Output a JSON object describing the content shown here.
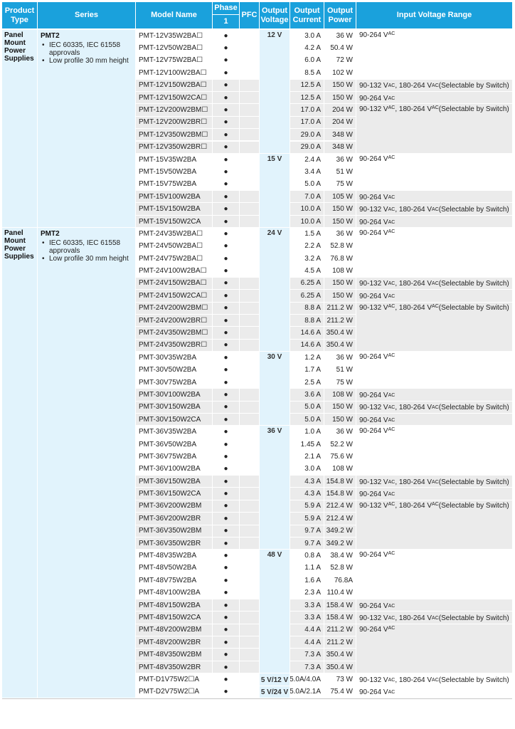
{
  "header": {
    "product_type": "Product Type",
    "series": "Series",
    "model_name": "Model Name",
    "phase": "Phase",
    "phase_sub": "1",
    "pfc": "PFC",
    "output_voltage": "Output Voltage",
    "output_current": "Output Current",
    "output_power": "Output Power",
    "input_voltage_range": "Input Voltage Range"
  },
  "sections": [
    {
      "product_type": "Panel Mount Power Supplies",
      "series_name": "PMT2",
      "series_bullets": [
        "IEC 60335, IEC 61558 approvals",
        "Low profile 30 mm height"
      ]
    },
    {
      "product_type": "Panel Mount Power Supplies",
      "series_name": "PMT2",
      "series_bullets": [
        "IEC 60335, IEC 61558 approvals",
        "Low profile 30 mm height"
      ]
    }
  ],
  "phase_mark": "●",
  "voltage_groups": [
    "12 V",
    "15 V",
    "24 V",
    "30 V",
    "36 V",
    "48 V",
    "5 V/12 V",
    "5 V/24 V"
  ],
  "input_ranges": [
    "90-264 VAC",
    "90-132 VAC, 180-264 VAC (Selectable by Switch)",
    "90-264 VAC",
    "90-132 VAC, 180-264 VAC (Selectable by Switch)",
    "90-264 VAC",
    "90-264 VAC",
    "90-132 VAC, 180-264 VAC (Selectable by Switch)",
    "90-264 VAC",
    "90-264 VAC",
    "90-132 VAC, 180-264 VAC (Selectable by Switch)",
    "90-264 VAC",
    "90-132 VAC, 180-264 VAC (Selectable by Switch)",
    "90-264 VAC",
    "90-264 VAC",
    "90-132 VAC, 180-264 VAC (Selectable by Switch)",
    "90-264 VAC",
    "90-264 VAC",
    "90-132 VAC, 180-264 VAC (Selectable by Switch)",
    "90-264 VAC",
    "90-132 VAC, 180-264 VAC (Selectable by Switch)",
    "90-264 VAC",
    "90-264 VAC",
    "90-132 VAC, 180-264 VAC (Selectable by Switch)",
    "90-264 VAC",
    "90-132 VAC, 180-264 VAC (Selectable by Switch)",
    "90-264 VAC"
  ],
  "rows": [
    {
      "model": "PMT-12V35W2BA☐",
      "current": "3.0 A",
      "power": "36 W"
    },
    {
      "model": "PMT-12V50W2BA☐",
      "current": "4.2 A",
      "power": "50.4 W"
    },
    {
      "model": "PMT-12V75W2BA☐",
      "current": "6.0 A",
      "power": "72 W"
    },
    {
      "model": "PMT-12V100W2BA☐",
      "current": "8.5 A",
      "power": "102 W"
    },
    {
      "model": "PMT-12V150W2BA☐",
      "current": "12.5 A",
      "power": "150 W"
    },
    {
      "model": "PMT-12V150W2CA☐",
      "current": "12.5 A",
      "power": "150 W"
    },
    {
      "model": "PMT-12V200W2BM☐",
      "current": "17.0 A",
      "power": "204 W"
    },
    {
      "model": "PMT-12V200W2BR☐",
      "current": "17.0 A",
      "power": "204 W"
    },
    {
      "model": "PMT-12V350W2BM☐",
      "current": "29.0 A",
      "power": "348 W"
    },
    {
      "model": "PMT-12V350W2BR☐",
      "current": "29.0 A",
      "power": "348 W"
    },
    {
      "model": "PMT-15V35W2BA",
      "current": "2.4 A",
      "power": "36 W"
    },
    {
      "model": "PMT-15V50W2BA",
      "current": "3.4 A",
      "power": "51 W"
    },
    {
      "model": "PMT-15V75W2BA",
      "current": "5.0 A",
      "power": "75 W"
    },
    {
      "model": "PMT-15V100W2BA",
      "current": "7.0 A",
      "power": "105 W"
    },
    {
      "model": "PMT-15V150W2BA",
      "current": "10.0 A",
      "power": "150 W"
    },
    {
      "model": "PMT-15V150W2CA",
      "current": "10.0 A",
      "power": "150 W"
    },
    {
      "model": "PMT-24V35W2BA☐",
      "current": "1.5 A",
      "power": "36 W"
    },
    {
      "model": "PMT-24V50W2BA☐",
      "current": "2.2 A",
      "power": "52.8 W"
    },
    {
      "model": "PMT-24V75W2BA☐",
      "current": "3.2 A",
      "power": "76.8 W"
    },
    {
      "model": "PMT-24V100W2BA☐",
      "current": "4.5 A",
      "power": "108 W"
    },
    {
      "model": "PMT-24V150W2BA☐",
      "current": "6.25 A",
      "power": "150 W"
    },
    {
      "model": "PMT-24V150W2CA☐",
      "current": "6.25 A",
      "power": "150 W"
    },
    {
      "model": "PMT-24V200W2BM☐",
      "current": "8.8 A",
      "power": "211.2 W"
    },
    {
      "model": "PMT-24V200W2BR☐",
      "current": "8.8 A",
      "power": "211.2 W"
    },
    {
      "model": "PMT-24V350W2BM☐",
      "current": "14.6 A",
      "power": "350.4 W"
    },
    {
      "model": "PMT-24V350W2BR☐",
      "current": "14.6 A",
      "power": "350.4 W"
    },
    {
      "model": "PMT-30V35W2BA",
      "current": "1.2 A",
      "power": "36 W"
    },
    {
      "model": "PMT-30V50W2BA",
      "current": "1.7 A",
      "power": "51 W"
    },
    {
      "model": "PMT-30V75W2BA",
      "current": "2.5 A",
      "power": "75 W"
    },
    {
      "model": "PMT-30V100W2BA",
      "current": "3.6 A",
      "power": "108 W"
    },
    {
      "model": "PMT-30V150W2BA",
      "current": "5.0 A",
      "power": "150 W"
    },
    {
      "model": "PMT-30V150W2CA",
      "current": "5.0 A",
      "power": "150 W"
    },
    {
      "model": "PMT-36V35W2BA",
      "current": "1.0 A",
      "power": "36 W"
    },
    {
      "model": "PMT-36V50W2BA",
      "current": "1.45 A",
      "power": "52.2 W"
    },
    {
      "model": "PMT-36V75W2BA",
      "current": "2.1 A",
      "power": "75.6 W"
    },
    {
      "model": "PMT-36V100W2BA",
      "current": "3.0 A",
      "power": "108 W"
    },
    {
      "model": "PMT-36V150W2BA",
      "current": "4.3 A",
      "power": "154.8 W"
    },
    {
      "model": "PMT-36V150W2CA",
      "current": "4.3 A",
      "power": "154.8 W"
    },
    {
      "model": "PMT-36V200W2BM",
      "current": "5.9 A",
      "power": "212.4 W"
    },
    {
      "model": "PMT-36V200W2BR",
      "current": "5.9 A",
      "power": "212.4 W"
    },
    {
      "model": "PMT-36V350W2BM",
      "current": "9.7 A",
      "power": "349.2 W"
    },
    {
      "model": "PMT-36V350W2BR",
      "current": "9.7 A",
      "power": "349.2 W"
    },
    {
      "model": "PMT-48V35W2BA",
      "current": "0.8 A",
      "power": "38.4 W"
    },
    {
      "model": "PMT-48V50W2BA",
      "current": "1.1 A",
      "power": "52.8 W"
    },
    {
      "model": "PMT-48V75W2BA",
      "current": "1.6 A",
      "power": "76.8A"
    },
    {
      "model": "PMT-48V100W2BA",
      "current": "2.3 A",
      "power": "110.4 W"
    },
    {
      "model": "PMT-48V150W2BA",
      "current": "3.3 A",
      "power": "158.4 W"
    },
    {
      "model": "PMT-48V150W2CA",
      "current": "3.3 A",
      "power": "158.4 W"
    },
    {
      "model": "PMT-48V200W2BM",
      "current": "4.4 A",
      "power": "211.2 W"
    },
    {
      "model": "PMT-48V200W2BR",
      "current": "4.4 A",
      "power": "211.2 W"
    },
    {
      "model": "PMT-48V350W2BM",
      "current": "7.3 A",
      "power": "350.4 W"
    },
    {
      "model": "PMT-48V350W2BR",
      "current": "7.3 A",
      "power": "350.4 W"
    },
    {
      "model": "PMT-D1V75W2☐A",
      "current": "5.0A/4.0A",
      "power": "73 W"
    },
    {
      "model": "PMT-D2V75W2☐A",
      "current": "5.0A/2.1A",
      "power": "75.4 W"
    }
  ]
}
